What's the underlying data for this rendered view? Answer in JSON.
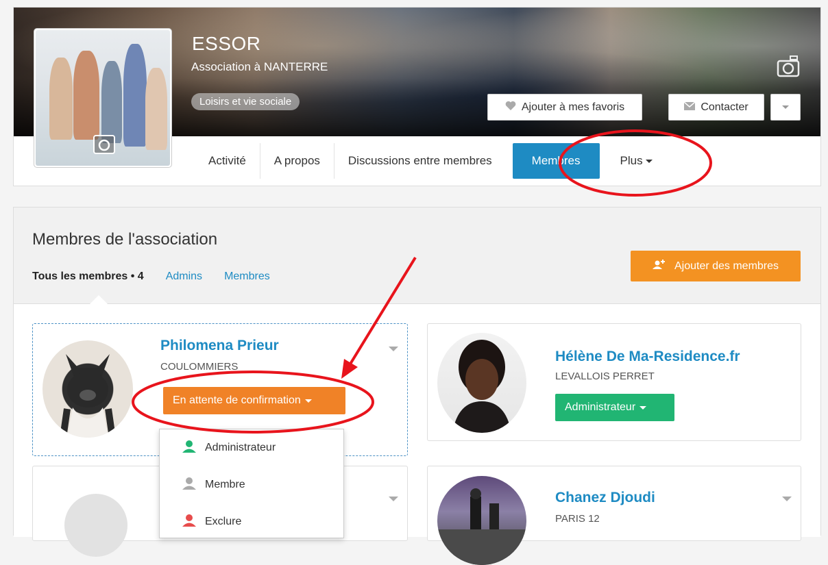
{
  "org": {
    "name": "ESSOR",
    "subtitle": "Association à NANTERRE",
    "category": "Loisirs et vie sociale"
  },
  "actions": {
    "favorite": "Ajouter à mes favoris",
    "contact": "Contacter"
  },
  "tabs": [
    {
      "label": "Activité"
    },
    {
      "label": "A propos"
    },
    {
      "label": "Discussions entre membres"
    },
    {
      "label": "Membres",
      "active": true
    },
    {
      "label": "Plus"
    }
  ],
  "members_panel": {
    "title": "Membres de l'association",
    "filter_all": "Tous les membres • 4",
    "filter_admins": "Admins",
    "filter_members": "Membres",
    "add_button": "Ajouter des membres"
  },
  "members": [
    {
      "name": "Philomena Prieur",
      "city": "COULOMMIERS",
      "role": "En attente de confirmation",
      "role_color": "#f08227"
    },
    {
      "name": "Hélène De Ma-Residence.fr",
      "city": "LEVALLOIS PERRET",
      "role": "Administrateur",
      "role_color": "#21b573"
    },
    {
      "name": "",
      "city": "",
      "role": ""
    },
    {
      "name": "Chanez Djoudi",
      "city": "PARIS 12",
      "role": ""
    }
  ],
  "role_menu": [
    {
      "label": "Administrateur",
      "icon": "user-green-icon",
      "color": "#21b573"
    },
    {
      "label": "Membre",
      "icon": "user-grey-icon",
      "color": "#aaaaaa"
    },
    {
      "label": "Exclure",
      "icon": "user-red-icon",
      "color": "#e74c4c"
    }
  ],
  "colors": {
    "accent_blue": "#1e8bc3",
    "orange": "#f39222",
    "green": "#21b573",
    "annotation_red": "#e8141c"
  }
}
